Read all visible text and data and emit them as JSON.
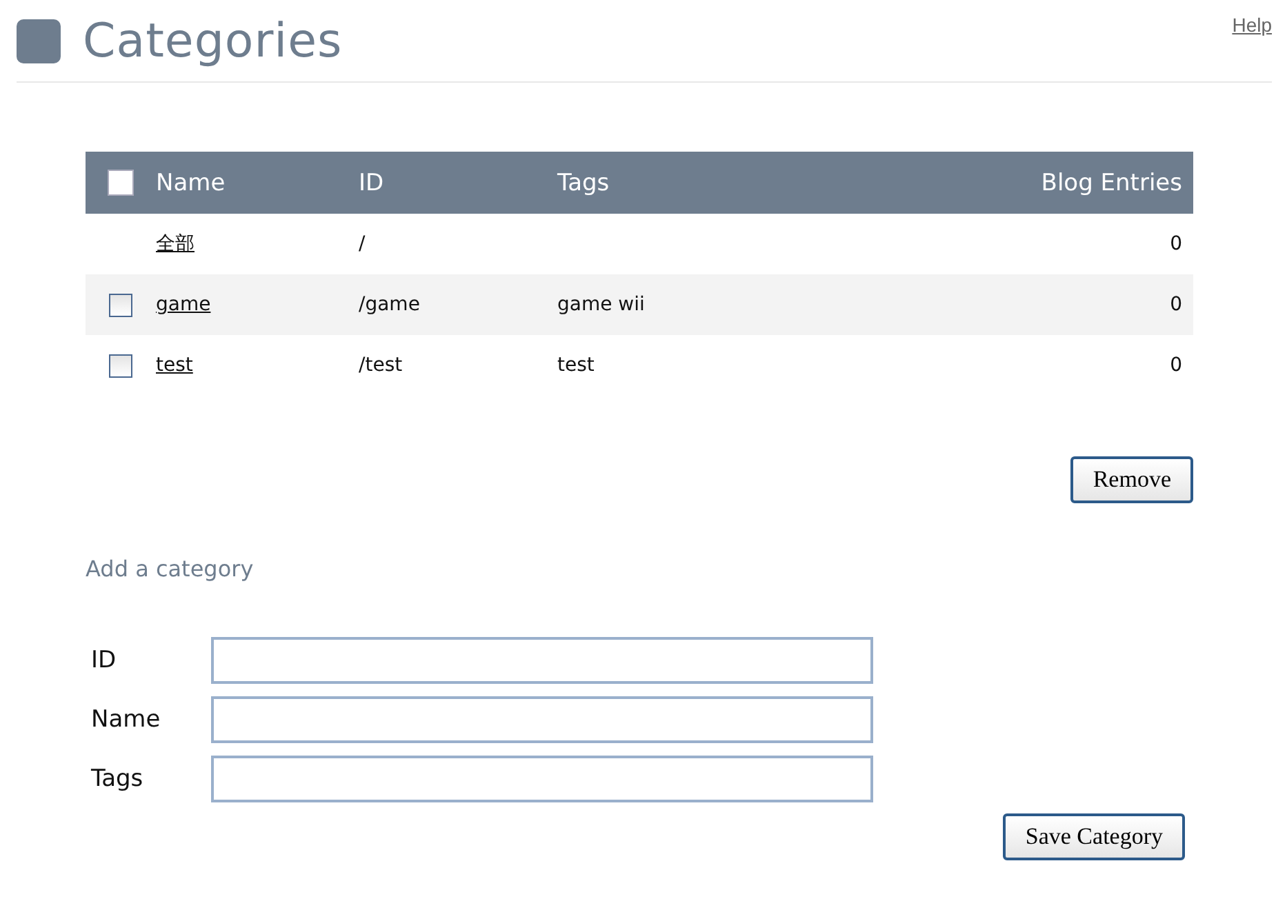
{
  "page": {
    "title": "Categories",
    "help_link": "Help"
  },
  "table": {
    "select_all": {
      "checked": false
    },
    "columns": [
      "Name",
      "ID",
      "Tags",
      "Blog Entries"
    ],
    "rows": [
      {
        "kind": "fixed",
        "name": "全部",
        "id": "/",
        "tags": "",
        "entries": "0"
      },
      {
        "kind": "selectable",
        "checked": false,
        "name": "game",
        "id": "/game",
        "tags": "game wii",
        "entries": "0"
      },
      {
        "kind": "selectable",
        "checked": false,
        "name": "test",
        "id": "/test",
        "tags": "test",
        "entries": "0"
      }
    ]
  },
  "remove_button": "Remove",
  "add_form": {
    "heading": "Add a category",
    "fields": [
      {
        "label": "ID"
      },
      {
        "label": "Name"
      },
      {
        "label": "Tags"
      }
    ],
    "submit": "Save Category"
  }
}
